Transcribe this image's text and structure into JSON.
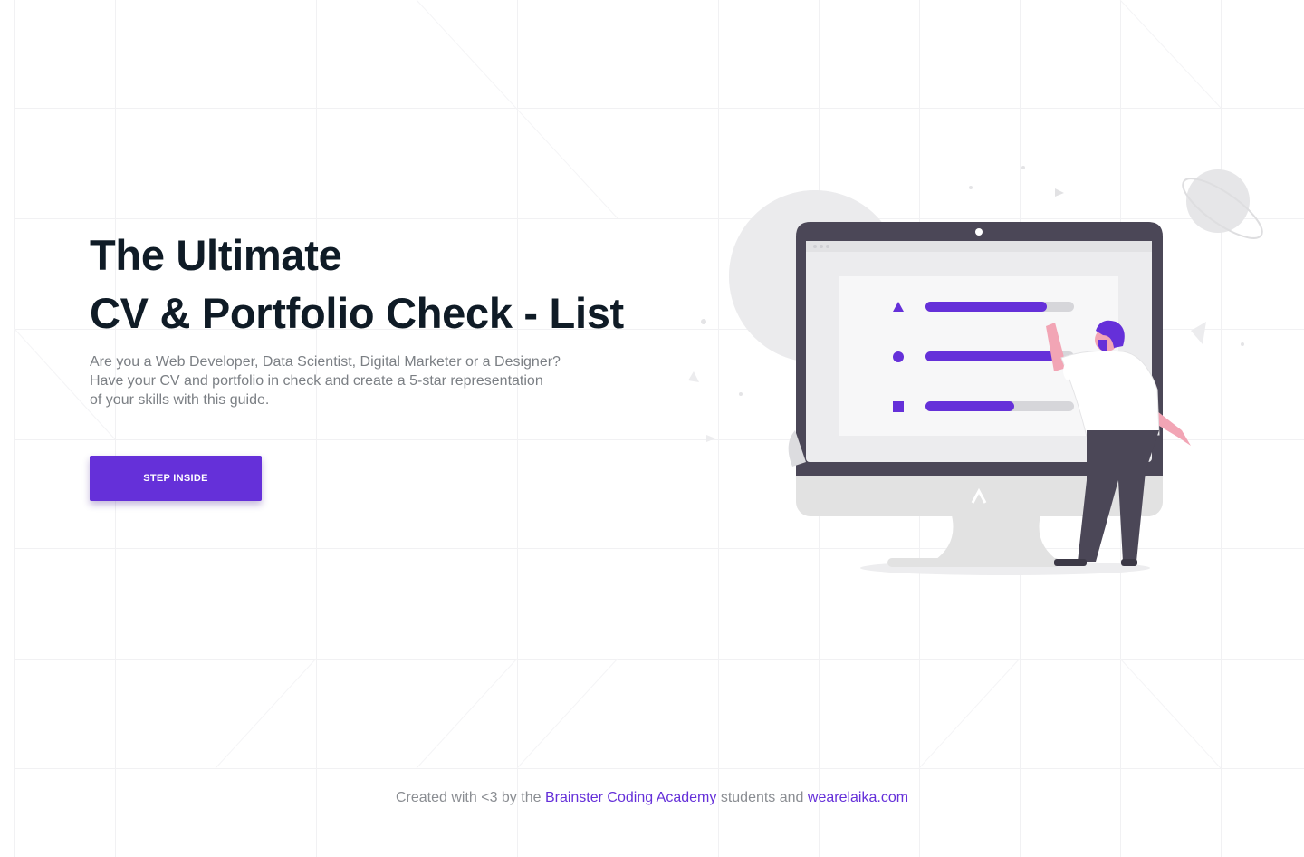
{
  "hero": {
    "title_line1": "The Ultimate",
    "title_line2": "CV & Portfolio Check - List",
    "description_line1": "Are you a Web Developer, Data Scientist, Digital Marketer or a Designer?",
    "description_line2": "Have your CV and portfolio in check and create a 5-star representation",
    "description_line3": "of your skills with this guide.",
    "cta_label": "STEP INSIDE"
  },
  "illustration": {
    "icons": [
      "triangle-icon",
      "circle-icon",
      "square-icon",
      "monitor-logo-icon",
      "planet-icon"
    ],
    "progress": [
      0.82,
      0.9,
      0.6
    ]
  },
  "footer": {
    "text_before": "Created with <3 by the ",
    "link1": "Brainster Coding Academy",
    "text_middle": " students and ",
    "link2": "wearelaika.com"
  },
  "colors": {
    "accent": "#6530d9",
    "title": "#0f1b26",
    "text_muted": "#7b7f84",
    "monitor_frame": "#4b4757",
    "stand": "#e2e2e2"
  }
}
